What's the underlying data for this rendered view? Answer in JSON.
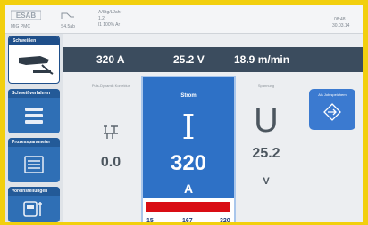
{
  "status": {
    "brand": "ESAB",
    "mode": "MIG PMC",
    "job": "S4.5ab",
    "params_line1": "A/Stg/LJahr",
    "params_line2": "1.2",
    "params_line3": "l1 100% Ar",
    "time": "08:48",
    "date": "30.03.14"
  },
  "sidebar": {
    "items": [
      {
        "label": "Schweißen",
        "icon": "welding-torch-icon",
        "active": true
      },
      {
        "label": "Schweißverfahren",
        "icon": "process-layers-icon",
        "active": false
      },
      {
        "label": "Prozessparameter",
        "icon": "parameters-list-icon",
        "active": false
      },
      {
        "label": "Voreinstellungen",
        "icon": "settings-icon",
        "active": false
      }
    ]
  },
  "readouts": {
    "current": "320 A",
    "voltage": "25.2 V",
    "wire_speed": "18.9 m/min"
  },
  "left_panel": {
    "label": "Puls-Dynamik Korrektur",
    "icon": "pulse-dynamics-icon",
    "value": "0.0"
  },
  "center_panel": {
    "label": "Strom",
    "symbol": "I",
    "value": "320",
    "unit": "A",
    "slider": {
      "min": "15",
      "mid": "167",
      "max": "320",
      "level": 1.0,
      "color": "#d90d14"
    }
  },
  "right_panel": {
    "label": "Spannung",
    "symbol": "U",
    "value": "25.2",
    "unit": "V"
  },
  "save_job": {
    "label": "Als Job speichern",
    "icon": "save-arrow-icon"
  },
  "colors": {
    "border": "#f2cf0e",
    "accent": "#2e71c6",
    "readbar": "#3b4c5e"
  }
}
